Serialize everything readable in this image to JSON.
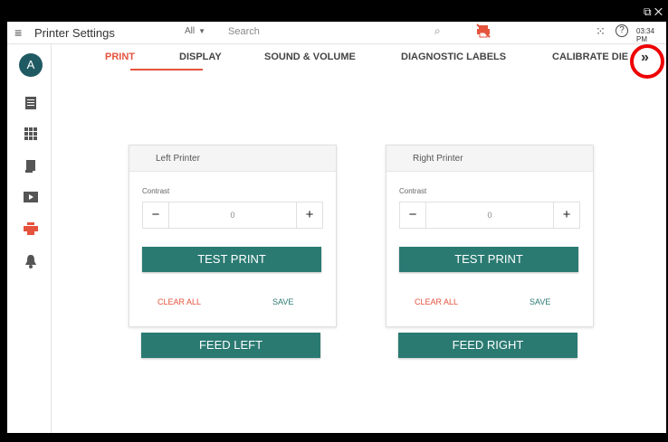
{
  "window": {
    "icons": "⧉ ✕"
  },
  "header": {
    "title": "Printer Settings",
    "filter_value": "All",
    "search_placeholder": "Search",
    "time": "03:34 PM",
    "help_glyph": "?"
  },
  "user": {
    "avatar_initial": "A"
  },
  "tabs": [
    {
      "label": "PRINT",
      "active": true
    },
    {
      "label": "DISPLAY",
      "active": false
    },
    {
      "label": "SOUND & VOLUME",
      "active": false
    },
    {
      "label": "DIAGNOSTIC LABELS",
      "active": false
    },
    {
      "label": "CALIBRATE DIE",
      "active": false
    }
  ],
  "next_tabs": "»",
  "printers": [
    {
      "title": "Left Printer",
      "contrast_label": "Contrast",
      "contrast_value": "0",
      "minus": "−",
      "plus": "+",
      "test_print": "TEST PRINT",
      "clear_all": "CLEAR ALL",
      "save": "SAVE",
      "feed": "FEED LEFT"
    },
    {
      "title": "Right Printer",
      "contrast_label": "Contrast",
      "contrast_value": "0",
      "minus": "−",
      "plus": "+",
      "test_print": "TEST PRINT",
      "clear_all": "CLEAR ALL",
      "save": "SAVE",
      "feed": "FEED RIGHT"
    }
  ],
  "colors": {
    "accent": "#e5533d",
    "primary": "#2a7a72",
    "avatar_bg": "#1f5a63"
  },
  "sidebar_icons": [
    "document-icon",
    "grid-icon",
    "receipt-icon",
    "video-icon",
    "printer-icon",
    "bell-icon"
  ]
}
